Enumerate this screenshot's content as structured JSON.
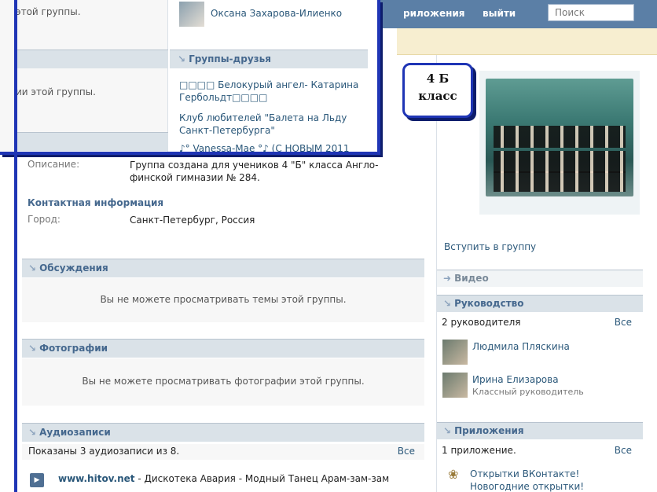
{
  "header": {
    "nav_apps": "риложения",
    "nav_logout": "выйти",
    "search_placeholder": "Поиск"
  },
  "badge": {
    "line1": "4 Б",
    "line2": "класс"
  },
  "overlay": {
    "left_text_1": "этой группы.",
    "left_text_2": "ии этой группы.",
    "member_name": "Оксана Захарова-Илиенко",
    "friends_title": "Группы-друзья",
    "friends": [
      "□□□□ Белокурый ангел- Катарина Гербольдт□□□□",
      "Клуб любителей \"Балета на Льду Санкт-Петербурга\"",
      "♪° Vanessa-Mae °♪ (С НОВЫМ 2011"
    ]
  },
  "info": {
    "desc_label": "Описание:",
    "desc_value_1": "Группа создана для учеников 4 \"Б\" класса Англо-",
    "desc_value_2": "финской гимназии № 284.",
    "contact_title": "Контактная информация",
    "city_label": "Город:",
    "city_value": "Санкт-Петербург, Россия"
  },
  "sections": {
    "discussions_title": "Обсуждения",
    "discussions_msg": "Вы не можете просматривать темы этой группы.",
    "photos_title": "Фотографии",
    "photos_msg": "Вы не можете просматривать фотографии этой группы.",
    "audio_title": "Аудиозаписи",
    "audio_count": "Показаны 3 аудиозаписи из 8.",
    "audio_all": "Все",
    "audio_track_site": "www.hitov.net",
    "audio_track_rest": " - Дискотека Авария - Модный Танец Арам-зам-зам"
  },
  "right": {
    "join": "Вступить в группу",
    "video": "Видео",
    "leaders_title": "Руководство",
    "leaders_count": "2 руководителя",
    "leaders_all": "Все",
    "leaders": [
      {
        "name": "Людмила Пляскина",
        "role": ""
      },
      {
        "name": "Ирина Елизарова",
        "role": "Классный руководитель"
      }
    ],
    "apps_title": "Приложения",
    "apps_count": "1 приложение.",
    "apps_all": "Все",
    "app_name": "Открытки ВКонтакте! Новогодние открытки!"
  }
}
